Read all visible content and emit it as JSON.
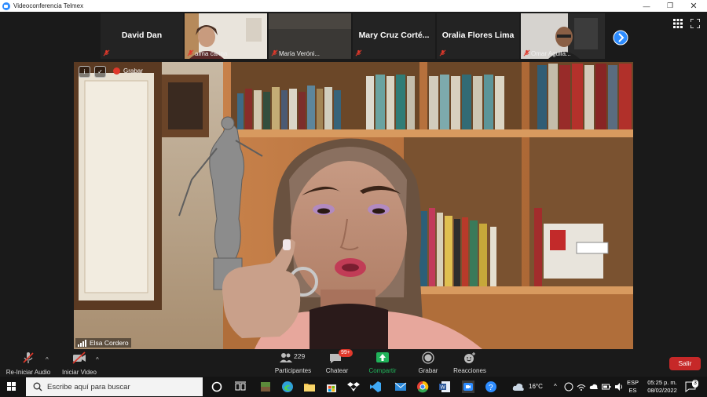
{
  "window": {
    "title": "Videoconferencia Telmex"
  },
  "gallery": {
    "tiles": [
      {
        "name": "David Dan",
        "label": ""
      },
      {
        "name": "",
        "label": "alma carina"
      },
      {
        "name": "",
        "label": "María Veróni..."
      },
      {
        "name": "Mary  Cruz  Corté...",
        "label": ""
      },
      {
        "name": "Oralia Flores Lima",
        "label": ""
      },
      {
        "name": "",
        "label": "Omar Aguila..."
      }
    ]
  },
  "main_video": {
    "record_label": "Grabar",
    "speaker_name": "Elsa Cordero"
  },
  "toolbar": {
    "audio_label": "Re-Iniciar Audio",
    "video_label": "Iniciar Video",
    "participants_label": "Participantes",
    "participants_count": "229",
    "chat_label": "Chatear",
    "chat_badge": "99+",
    "share_label": "Compartir",
    "record_label": "Grabar",
    "reactions_label": "Reacciones",
    "leave_label": "Salir"
  },
  "taskbar": {
    "search_placeholder": "Escribe aquí para buscar",
    "temperature": "16°C",
    "language": "ESP",
    "language_sub": "ES",
    "time": "05:25 p. m.",
    "date": "08/02/2022",
    "notification_count": "3"
  },
  "colors": {
    "zoom_blue": "#2d8cff",
    "share_green": "#20b35a",
    "leave_red": "#c62828",
    "muted_red": "#e0382b"
  }
}
